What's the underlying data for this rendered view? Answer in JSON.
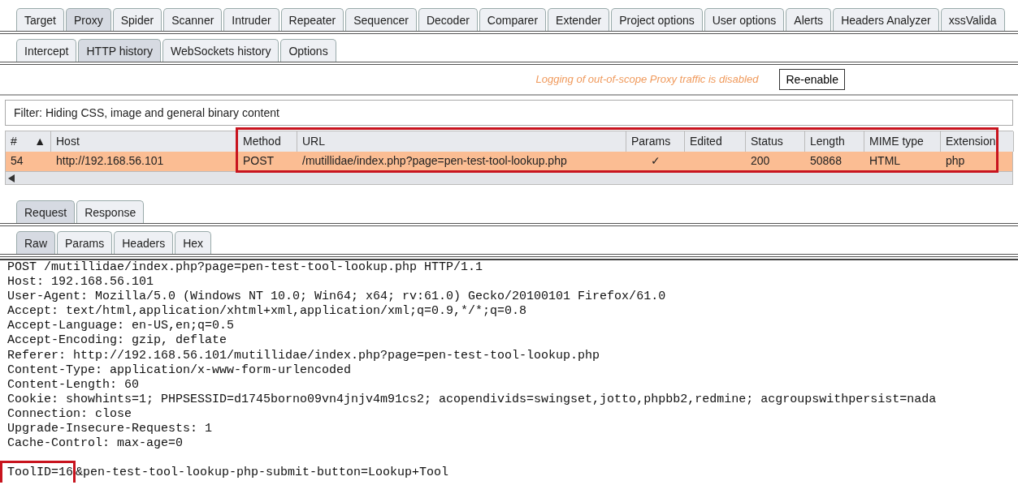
{
  "main_tabs": [
    {
      "label": "Target",
      "selected": false
    },
    {
      "label": "Proxy",
      "selected": true
    },
    {
      "label": "Spider",
      "selected": false
    },
    {
      "label": "Scanner",
      "selected": false
    },
    {
      "label": "Intruder",
      "selected": false
    },
    {
      "label": "Repeater",
      "selected": false
    },
    {
      "label": "Sequencer",
      "selected": false
    },
    {
      "label": "Decoder",
      "selected": false
    },
    {
      "label": "Comparer",
      "selected": false
    },
    {
      "label": "Extender",
      "selected": false
    },
    {
      "label": "Project options",
      "selected": false
    },
    {
      "label": "User options",
      "selected": false
    },
    {
      "label": "Alerts",
      "selected": false
    },
    {
      "label": "Headers Analyzer",
      "selected": false
    },
    {
      "label": "xssValida",
      "selected": false
    }
  ],
  "proxy_tabs": [
    {
      "label": "Intercept",
      "selected": false
    },
    {
      "label": "HTTP history",
      "selected": true
    },
    {
      "label": "WebSockets history",
      "selected": false
    },
    {
      "label": "Options",
      "selected": false
    }
  ],
  "logging_notice": {
    "message": "Logging of out-of-scope Proxy traffic is disabled",
    "button": "Re-enable"
  },
  "filter": "Filter: Hiding CSS, image and general binary content",
  "table": {
    "sort_indicator": "▲",
    "columns": [
      "#",
      "Host",
      "Method",
      "URL",
      "Params",
      "Edited",
      "Status",
      "Length",
      "MIME type",
      "Extension"
    ],
    "rows": [
      {
        "selected": true,
        "cells": [
          "54",
          "http://192.168.56.101",
          "POST",
          "/mutillidae/index.php?page=pen-test-tool-lookup.php",
          "✓",
          "",
          "200",
          "50868",
          "HTML",
          "php"
        ]
      }
    ]
  },
  "message_tabs": [
    {
      "label": "Request",
      "selected": true
    },
    {
      "label": "Response",
      "selected": false
    }
  ],
  "view_tabs": [
    {
      "label": "Raw",
      "selected": true
    },
    {
      "label": "Params",
      "selected": false
    },
    {
      "label": "Headers",
      "selected": false
    },
    {
      "label": "Hex",
      "selected": false
    }
  ],
  "request_headers": [
    "POST /mutillidae/index.php?page=pen-test-tool-lookup.php HTTP/1.1",
    "Host: 192.168.56.101",
    "User-Agent: Mozilla/5.0 (Windows NT 10.0; Win64; x64; rv:61.0) Gecko/20100101 Firefox/61.0",
    "Accept: text/html,application/xhtml+xml,application/xml;q=0.9,*/*;q=0.8",
    "Accept-Language: en-US,en;q=0.5",
    "Accept-Encoding: gzip, deflate",
    "Referer: http://192.168.56.101/mutillidae/index.php?page=pen-test-tool-lookup.php",
    "Content-Type: application/x-www-form-urlencoded",
    "Content-Length: 60",
    "Cookie: showhints=1; PHPSESSID=d1745borno09vn4jnjv4m91cs2; acopendivids=swingset,jotto,phpbb2,redmine; acgroupswithpersist=nada",
    "Connection: close",
    "Upgrade-Insecure-Requests: 1",
    "Cache-Control: max-age=0"
  ],
  "request_body": {
    "marked": "ToolID=16",
    "rest": "&pen-test-tool-lookup-php-submit-button=Lookup+Tool"
  }
}
